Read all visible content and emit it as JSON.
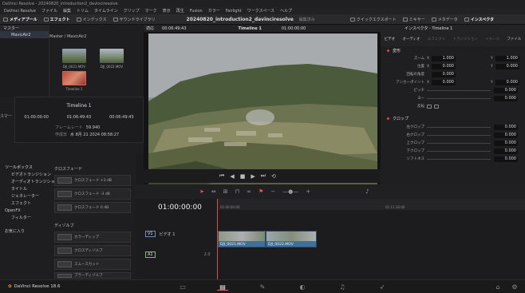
{
  "app": {
    "title_bar": "DaVinci Resolve - 20240820_introduction2_davinciresolve",
    "footer": "DaVinci Resolve 18.6"
  },
  "menu": [
    "DaVinci Resolve",
    "ファイル",
    "編集",
    "トリム",
    "タイムライン",
    "クリップ",
    "マーク",
    "表示",
    "再生",
    "Fusion",
    "カラー",
    "Fairlight",
    "ワークスペース",
    "ヘルプ"
  ],
  "toolbar": {
    "media_pool": "メディアプール",
    "effects": "エフェクト",
    "index": "インデックス",
    "sound_library": "サウンドライブラリ",
    "project": "20240820_introduction2_davinciresolve",
    "edited": "編集済み",
    "quick_export": "クイックエクスポート",
    "mixer": "ミキサー",
    "metadata": "メタデータ",
    "inspector": "インスペクタ"
  },
  "media_pool": {
    "master_label": "マスター",
    "bin": "MavicAir2",
    "path": "Master / MavicAir2",
    "clips": [
      "DJI_0021.MOV",
      "DJI_0022.MOV",
      "Timeline 1"
    ]
  },
  "clip_info": {
    "name": "Timeline 1",
    "tc_start": "01:00:00:00",
    "tc_end": "01:06:49:43",
    "tc_dur": "00:06:49:43",
    "fps_label": "フレームレート",
    "fps": "59.940",
    "created_label": "作成日",
    "created": "水 8月 21 2024 08:58:27"
  },
  "side_label": "スマー",
  "viewer": {
    "zoom": "適応",
    "timecode": "00:06:49:43",
    "timeline": "Timeline 1",
    "tc": "01:00:00:00"
  },
  "inspector": {
    "title": "インスペクタ - Timeline 1",
    "tabs": [
      "ビデオ",
      "オーディオ",
      "エフェクト",
      "トランジション",
      "イメージ",
      "ファイル"
    ],
    "transform": "変形",
    "zoom": "ズーム",
    "zoom_x": "1.000",
    "zoom_y": "1.000",
    "position": "位置",
    "pos_x": "0.000",
    "pos_y": "0.000",
    "rotation": "回転の角度",
    "rotation_v": "0.000",
    "anchor": "アンカーポイント",
    "anchor_x": "0.000",
    "anchor_y": "0.000",
    "pitch": "ピッチ",
    "pitch_v": "0.000",
    "yaw": "ヨー",
    "yaw_v": "0.000",
    "flip": "反転",
    "crop": "クロップ",
    "crop_left": "左クロップ",
    "crop_left_v": "0.000",
    "crop_right": "右クロップ",
    "crop_right_v": "0.000",
    "crop_top": "上クロップ",
    "crop_top_v": "0.000",
    "crop_bottom": "下クロップ",
    "crop_bottom_v": "0.000",
    "softness": "ソフトネス",
    "softness_v": "0.000"
  },
  "effects": {
    "toolbox": "ツールボックス",
    "items": [
      "ビデオトランジション",
      "オーディオトランジション",
      "タイトル",
      "ジェネレーター",
      "エフェクト"
    ],
    "openfx": "OpenFX",
    "filters": "フィルター",
    "favorites": "お気に入り",
    "cross_fade": "クロスフェード",
    "cf1": "クロスフェード +3 dB",
    "cf2": "クロスフェード -3 dB",
    "cf3": "クロスフェード 0 dB",
    "dip": "ディゾルブ",
    "d1": "カラーディップ",
    "d2": "クロスディゾルブ",
    "d3": "スムースカット",
    "d4": "ブラーディゾルブ"
  },
  "timeline": {
    "tc": "01:00:00:00",
    "ruler_start": "01:00:00:00",
    "ruler_end": "01:11:16:00",
    "v1": "V1",
    "video_track": "ビデオ 1",
    "a1": "A1",
    "clip1": "DJI_0021.MOV",
    "clip2": "DJI_0022.MOV",
    "a_level": "2.0"
  },
  "colors": {
    "accent": "#e24a4a",
    "clip": "#3f6f9a",
    "playhead": "#e24a4a"
  }
}
